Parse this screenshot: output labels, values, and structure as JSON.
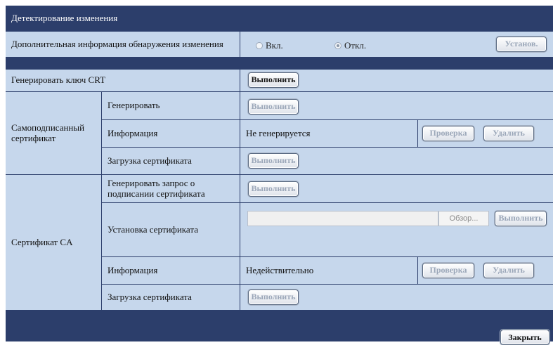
{
  "header": {
    "title": "Детектирование изменения"
  },
  "rows": {
    "extra_info": {
      "label": "Дополнительная информация обнаружения изменения",
      "radio_on_label": "Вкл.",
      "radio_off_label": "Откл.",
      "selected": "Откл.",
      "set_button": "Установ."
    },
    "crt_key": {
      "label": "Генерировать ключ CRT",
      "button": "Выполнить"
    },
    "self_signed": {
      "group_label": "Самоподписанный сертификат",
      "generate": {
        "label": "Генерировать",
        "button": "Выполнить"
      },
      "info": {
        "label": "Информация",
        "value": "Не генерируется",
        "check_button": "Проверка",
        "delete_button": "Удалить"
      },
      "download": {
        "label": "Загрузка сертификата",
        "button": "Выполнить"
      }
    },
    "ca": {
      "group_label": "Сертификат CA",
      "request": {
        "label": "Генерировать запрос о подписании сертификата",
        "button": "Выполнить"
      },
      "install": {
        "label": "Установка сертификата",
        "file_value": "",
        "browse_button": "Обзор...",
        "button": "Выполнить"
      },
      "info": {
        "label": "Информация",
        "value": "Недействительно",
        "check_button": "Проверка",
        "delete_button": "Удалить"
      },
      "download": {
        "label": "Загрузка сертификата",
        "button": "Выполнить"
      }
    }
  },
  "footer": {
    "close_button": "Закрыть"
  },
  "colors": {
    "panel": "#2c3e6b",
    "cell": "#c6d7ec"
  }
}
